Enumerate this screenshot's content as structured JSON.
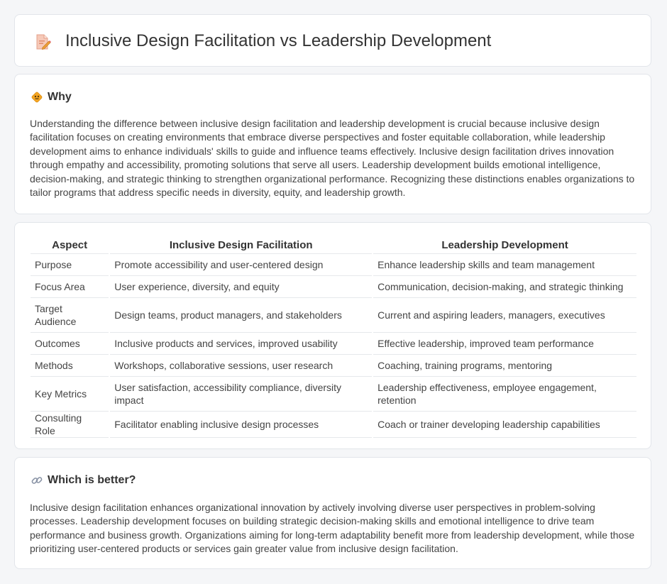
{
  "header": {
    "title": "Inclusive Design Facilitation vs Leadership Development",
    "icon": "document-pencil-icon"
  },
  "why": {
    "icon": "diamond-sign-icon",
    "title": "Why",
    "body": "Understanding the difference between inclusive design facilitation and leadership development is crucial because inclusive design facilitation focuses on creating environments that embrace diverse perspectives and foster equitable collaboration, while leadership development aims to enhance individuals' skills to guide and influence teams effectively. Inclusive design facilitation drives innovation through empathy and accessibility, promoting solutions that serve all users. Leadership development builds emotional intelligence, decision-making, and strategic thinking to strengthen organizational performance. Recognizing these distinctions enables organizations to tailor programs that address specific needs in diversity, equity, and leadership growth."
  },
  "table": {
    "headers": [
      "Aspect",
      "Inclusive Design Facilitation",
      "Leadership Development"
    ],
    "rows": [
      [
        "Purpose",
        "Promote accessibility and user-centered design",
        "Enhance leadership skills and team management"
      ],
      [
        "Focus Area",
        "User experience, diversity, and equity",
        "Communication, decision-making, and strategic thinking"
      ],
      [
        "Target Audience",
        "Design teams, product managers, and stakeholders",
        "Current and aspiring leaders, managers, executives"
      ],
      [
        "Outcomes",
        "Inclusive products and services, improved usability",
        "Effective leadership, improved team performance"
      ],
      [
        "Methods",
        "Workshops, collaborative sessions, user research",
        "Coaching, training programs, mentoring"
      ],
      [
        "Key Metrics",
        "User satisfaction, accessibility compliance, diversity impact",
        "Leadership effectiveness, employee engagement, retention"
      ],
      [
        "Consulting Role",
        "Facilitator enabling inclusive design processes",
        "Coach or trainer developing leadership capabilities"
      ]
    ]
  },
  "better": {
    "icon": "link-icon",
    "title": "Which is better?",
    "body": "Inclusive design facilitation enhances organizational innovation by actively involving diverse user perspectives in problem-solving processes. Leadership development focuses on building strategic decision-making skills and emotional intelligence to drive team performance and business growth. Organizations aiming for long-term adaptability benefit more from leadership development, while those prioritizing user-centered products or services gain greater value from inclusive design facilitation."
  }
}
